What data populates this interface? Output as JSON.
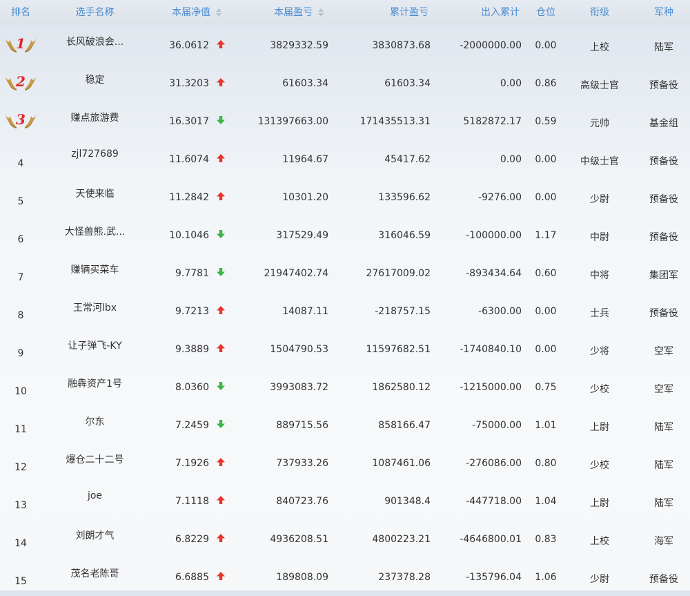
{
  "header": {
    "rank": "排名",
    "name": "选手名称",
    "nav": "本届净值",
    "profit": "本届盈亏",
    "total": "累计盈亏",
    "io": "出入累计",
    "position": "仓位",
    "title": "衔级",
    "army": "军种"
  },
  "colors": {
    "header_text": "#4b8bd1",
    "up_arrow": "#e8352c",
    "down_arrow": "#3bb54a",
    "medal_number": "#e0262b"
  },
  "rows": [
    {
      "rank": "1",
      "name": "长风破浪会...",
      "nav": "36.0612",
      "trend": "up",
      "profit": "3829332.59",
      "total": "3830873.68",
      "io": "-2000000.00",
      "position": "0.00",
      "title": "上校",
      "army": "陆军",
      "medal": true
    },
    {
      "rank": "2",
      "name": "稳定",
      "nav": "31.3203",
      "trend": "up",
      "profit": "61603.34",
      "total": "61603.34",
      "io": "0.00",
      "position": "0.86",
      "title": "高级士官",
      "army": "预备役",
      "medal": true
    },
    {
      "rank": "3",
      "name": "赚点旅游费",
      "nav": "16.3017",
      "trend": "down",
      "profit": "131397663.00",
      "total": "171435513.31",
      "io": "5182872.17",
      "position": "0.59",
      "title": "元帅",
      "army": "基金组",
      "medal": true
    },
    {
      "rank": "4",
      "name": "zjl727689",
      "nav": "11.6074",
      "trend": "up",
      "profit": "11964.67",
      "total": "45417.62",
      "io": "0.00",
      "position": "0.00",
      "title": "中级士官",
      "army": "预备役",
      "medal": false
    },
    {
      "rank": "5",
      "name": "天使来临",
      "nav": "11.2842",
      "trend": "up",
      "profit": "10301.20",
      "total": "133596.62",
      "io": "-9276.00",
      "position": "0.00",
      "title": "少尉",
      "army": "预备役",
      "medal": false
    },
    {
      "rank": "6",
      "name": "大怪兽熊.武...",
      "nav": "10.1046",
      "trend": "down",
      "profit": "317529.49",
      "total": "316046.59",
      "io": "-100000.00",
      "position": "1.17",
      "title": "中尉",
      "army": "预备役",
      "medal": false
    },
    {
      "rank": "7",
      "name": "赚辆买菜车",
      "nav": "9.7781",
      "trend": "down",
      "profit": "21947402.74",
      "total": "27617009.02",
      "io": "-893434.64",
      "position": "0.60",
      "title": "中将",
      "army": "集团军",
      "medal": false
    },
    {
      "rank": "8",
      "name": "王常河lbx",
      "nav": "9.7213",
      "trend": "up",
      "profit": "14087.11",
      "total": "-218757.15",
      "io": "-6300.00",
      "position": "0.00",
      "title": "士兵",
      "army": "预备役",
      "medal": false
    },
    {
      "rank": "9",
      "name": "让子弹飞-KY",
      "nav": "9.3889",
      "trend": "up",
      "profit": "1504790.53",
      "total": "11597682.51",
      "io": "-1740840.10",
      "position": "0.00",
      "title": "少将",
      "army": "空军",
      "medal": false
    },
    {
      "rank": "10",
      "name": "融犇资产1号",
      "nav": "8.0360",
      "trend": "down",
      "profit": "3993083.72",
      "total": "1862580.12",
      "io": "-1215000.00",
      "position": "0.75",
      "title": "少校",
      "army": "空军",
      "medal": false
    },
    {
      "rank": "11",
      "name": "尔东",
      "nav": "7.2459",
      "trend": "down",
      "profit": "889715.56",
      "total": "858166.47",
      "io": "-75000.00",
      "position": "1.01",
      "title": "上尉",
      "army": "陆军",
      "medal": false
    },
    {
      "rank": "12",
      "name": "爆仓二十二号",
      "nav": "7.1926",
      "trend": "up",
      "profit": "737933.26",
      "total": "1087461.06",
      "io": "-276086.00",
      "position": "0.80",
      "title": "少校",
      "army": "陆军",
      "medal": false
    },
    {
      "rank": "13",
      "name": "joe",
      "nav": "7.1118",
      "trend": "up",
      "profit": "840723.76",
      "total": "901348.4",
      "io": "-447718.00",
      "position": "1.04",
      "title": "上尉",
      "army": "陆军",
      "medal": false
    },
    {
      "rank": "14",
      "name": "刘朗才气",
      "nav": "6.8229",
      "trend": "up",
      "profit": "4936208.51",
      "total": "4800223.21",
      "io": "-4646800.01",
      "position": "0.83",
      "title": "上校",
      "army": "海军",
      "medal": false
    },
    {
      "rank": "15",
      "name": "茂名老陈哥",
      "nav": "6.6885",
      "trend": "up",
      "profit": "189808.09",
      "total": "237378.28",
      "io": "-135796.04",
      "position": "1.06",
      "title": "少尉",
      "army": "预备役",
      "medal": false
    }
  ]
}
